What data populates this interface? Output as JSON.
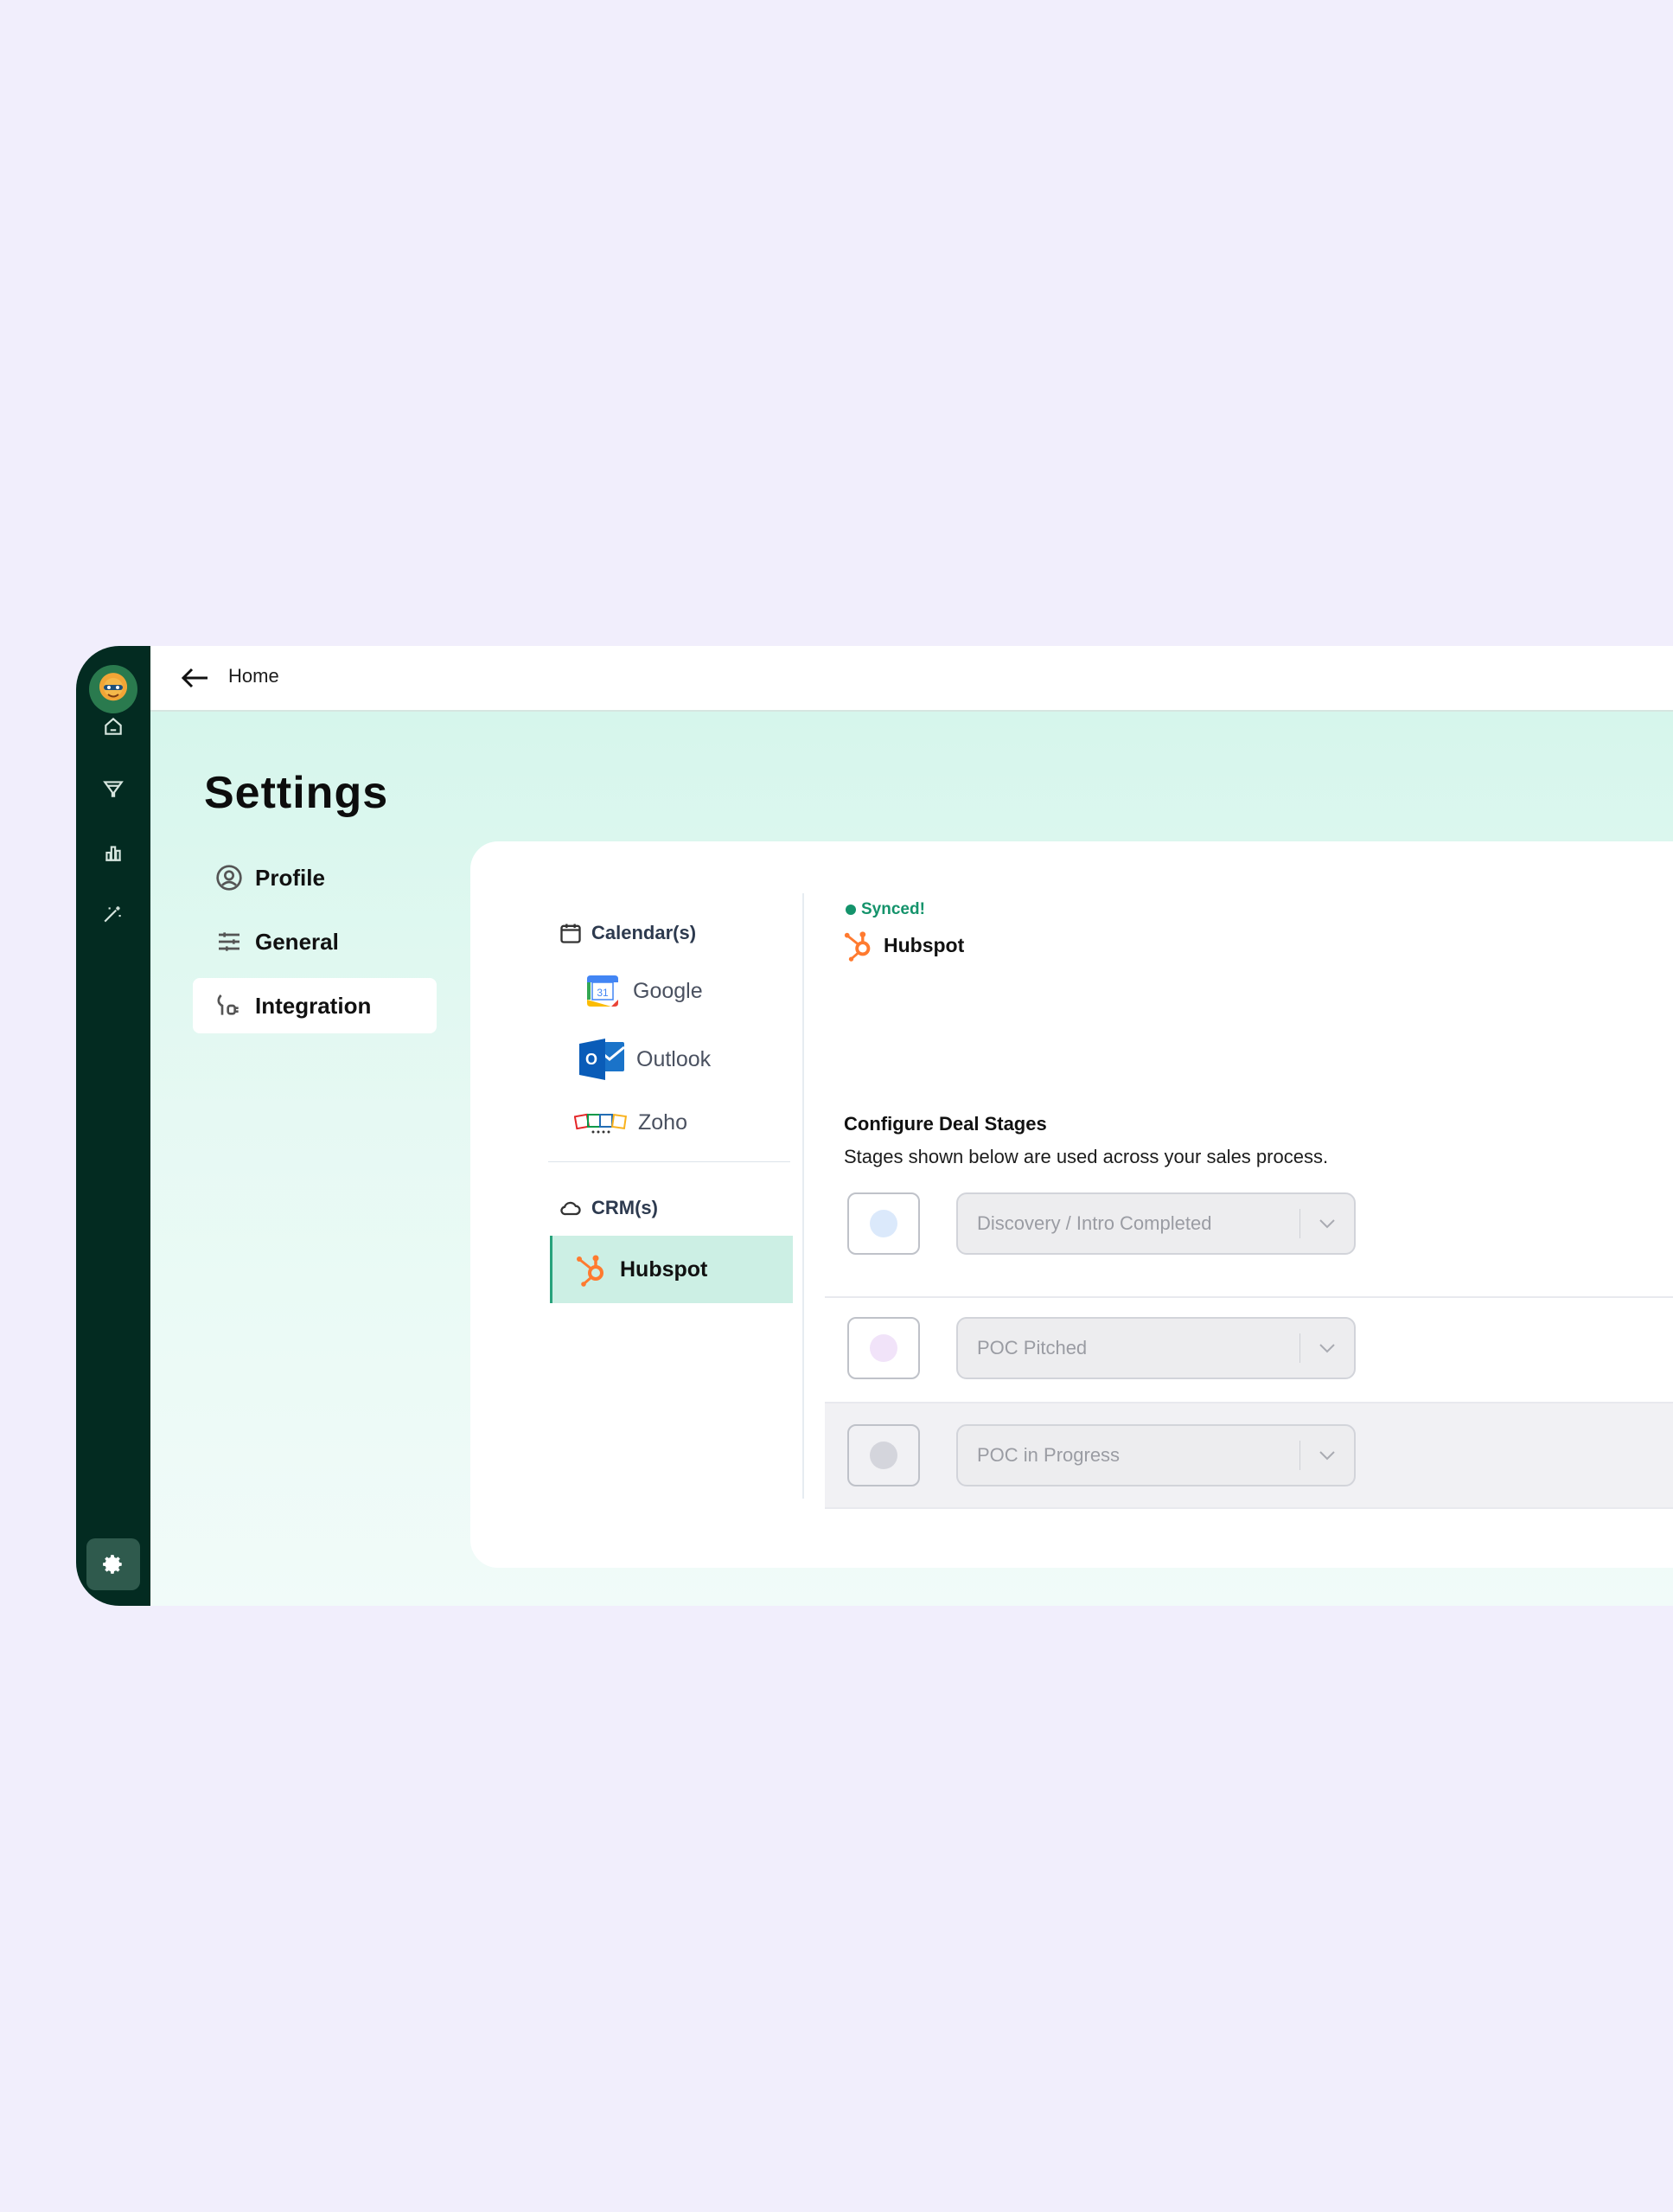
{
  "topbar": {
    "home_label": "Home"
  },
  "page_title": "Settings",
  "side_menu": [
    {
      "label": "Profile",
      "icon": "user-circle-icon"
    },
    {
      "label": "General",
      "icon": "sliders-icon"
    },
    {
      "label": "Integration",
      "icon": "plug-icon",
      "active": true
    }
  ],
  "integrations": {
    "calendars_header": "Calendar(s)",
    "calendars": [
      {
        "label": "Google",
        "icon": "google-calendar-icon",
        "badge": "31"
      },
      {
        "label": "Outlook",
        "icon": "outlook-icon",
        "badge": "O"
      },
      {
        "label": "Zoho",
        "icon": "zoho-icon"
      }
    ],
    "crms_header": "CRM(s)",
    "crms": [
      {
        "label": "Hubspot",
        "icon": "hubspot-icon",
        "active": true
      }
    ]
  },
  "detail": {
    "status": "Synced!",
    "status_color": "#14936b",
    "crm_name": "Hubspot",
    "config_title": "Configure Deal Stages",
    "config_subtitle": "Stages shown below are used across your sales process.",
    "stages": [
      {
        "label": "Discovery / Intro Completed",
        "color": "#dbe9fb"
      },
      {
        "label": "POC Pitched",
        "color": "#f1e3f9"
      },
      {
        "label": "POC in Progress",
        "color": "#d4d5dc"
      }
    ]
  },
  "colors": {
    "rail": "#032b21",
    "accent": "#27a27b",
    "hubspot": "#ff7a2f",
    "background": "#f1eefc"
  }
}
